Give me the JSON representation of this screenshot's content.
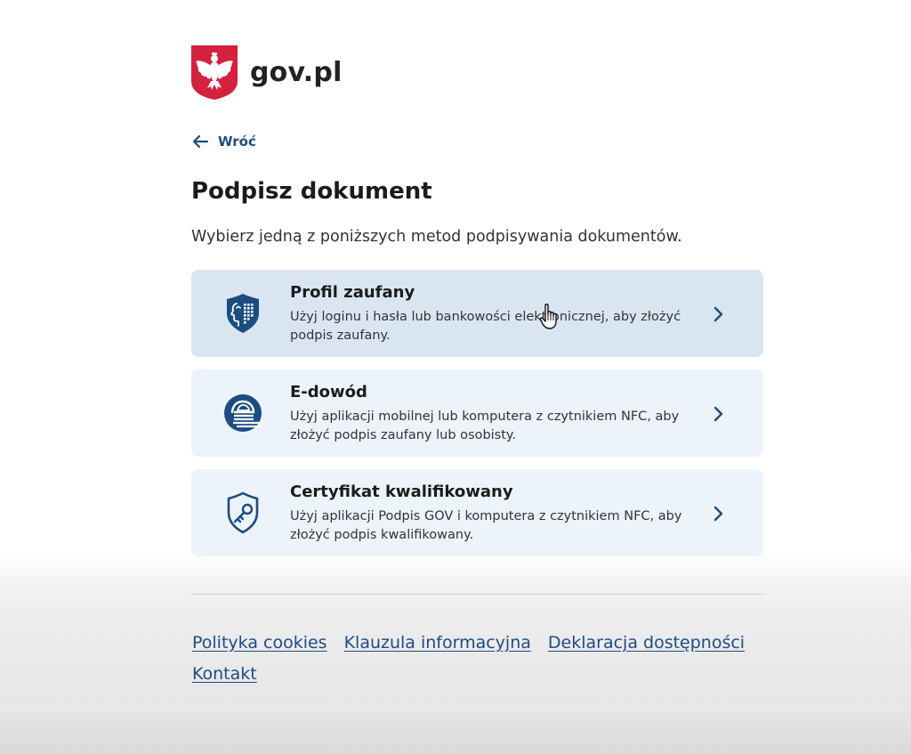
{
  "header": {
    "logo_text": "gov.pl",
    "emblem_icon": "polish-eagle-emblem-icon"
  },
  "nav": {
    "back_label": "Wróć"
  },
  "page": {
    "title": "Podpisz dokument",
    "intro": "Wybierz jedną z poniższych metod podpisywania dokumentów."
  },
  "options": [
    {
      "title": "Profil zaufany",
      "description": "Użyj loginu i hasła lub bankowości elektronicznej, aby złożyć podpis zaufany.",
      "icon": "trusted-profile-icon",
      "state": "hover"
    },
    {
      "title": "E-dowód",
      "description": "Użyj aplikacji mobilnej lub komputera z czytnikiem NFC, aby złożyć podpis zaufany lub osobisty.",
      "icon": "e-id-icon",
      "state": "default"
    },
    {
      "title": "Certyfikat kwalifikowany",
      "description": "Użyj aplikacji Podpis GOV i komputera z czytnikiem NFC, aby złożyć podpis kwalifikowany.",
      "icon": "qualified-certificate-icon",
      "state": "default"
    }
  ],
  "footer": {
    "links": [
      "Polityka cookies",
      "Klauzula informacyjna",
      "Deklaracja dostępności",
      "Kontakt"
    ]
  },
  "colors": {
    "accent": "#1d4c82",
    "card_bg": "#edf3fa",
    "card_hover_bg": "#d9e6f2",
    "emblem_red": "#d4213d"
  }
}
